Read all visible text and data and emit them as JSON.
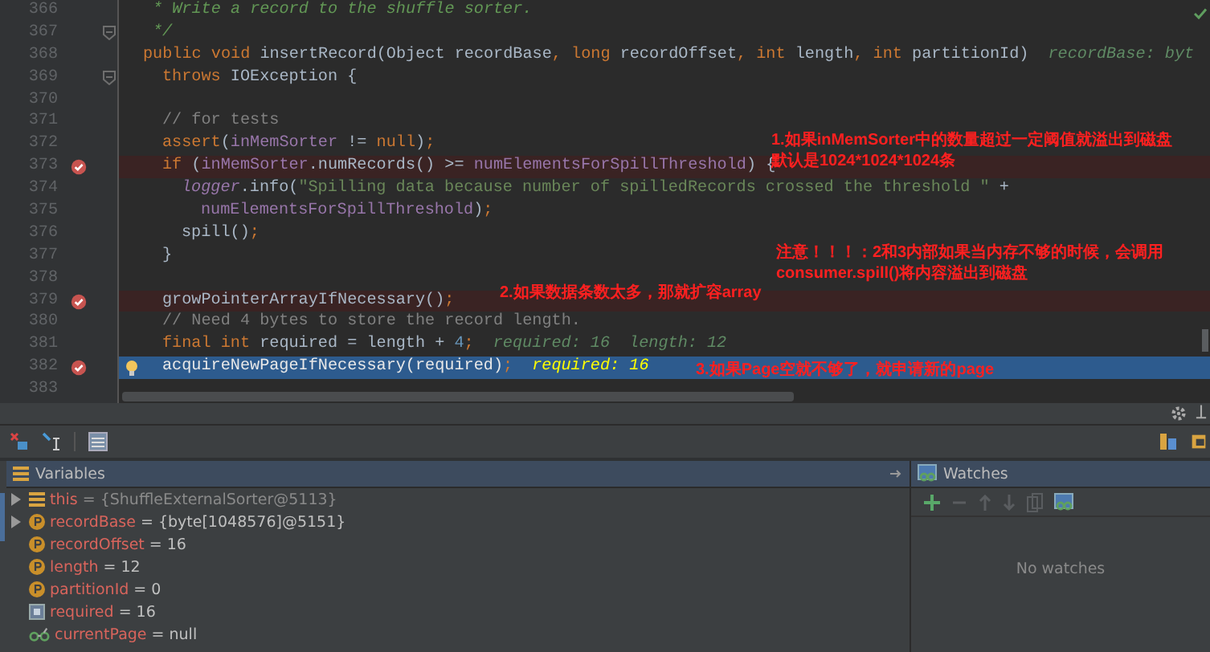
{
  "editor": {
    "lines": [
      {
        "number": "366",
        "tokens": [
          {
            "kind": "doc",
            "text": " * Write a record to the shuffle sorter."
          }
        ]
      },
      {
        "number": "367",
        "fold": true,
        "tokens": [
          {
            "kind": "doc",
            "text": " */"
          }
        ]
      },
      {
        "number": "368",
        "tokens": [
          {
            "kind": "keyword",
            "text": "public void "
          },
          {
            "kind": "plain",
            "text": "insertRecord(Object recordBase"
          },
          {
            "kind": "keyword",
            "text": ", long "
          },
          {
            "kind": "plain",
            "text": "recordOffset"
          },
          {
            "kind": "keyword",
            "text": ", int "
          },
          {
            "kind": "plain",
            "text": "length"
          },
          {
            "kind": "keyword",
            "text": ", int "
          },
          {
            "kind": "plain",
            "text": "partitionId)"
          }
        ],
        "hints": [
          "recordBase: byt"
        ]
      },
      {
        "number": "369",
        "fold": true,
        "tokens": [
          {
            "kind": "keyword",
            "text": "  throws "
          },
          {
            "kind": "plain",
            "text": "IOException {"
          }
        ]
      },
      {
        "number": "370"
      },
      {
        "number": "371",
        "tokens": [
          {
            "kind": "comment",
            "text": "  // for tests"
          }
        ]
      },
      {
        "number": "372",
        "tokens": [
          {
            "kind": "keyword",
            "text": "  assert"
          },
          {
            "kind": "plain",
            "text": "("
          },
          {
            "kind": "field",
            "text": "inMemSorter"
          },
          {
            "kind": "plain",
            "text": " != "
          },
          {
            "kind": "keyword",
            "text": "null"
          },
          {
            "kind": "plain",
            "text": ")"
          },
          {
            "kind": "keyword",
            "text": ";"
          }
        ]
      },
      {
        "number": "373",
        "breakpoint": true,
        "tokens": [
          {
            "kind": "keyword",
            "text": "  if "
          },
          {
            "kind": "plain",
            "text": "("
          },
          {
            "kind": "field",
            "text": "inMemSorter"
          },
          {
            "kind": "plain",
            "text": ".numRecords() >= "
          },
          {
            "kind": "field",
            "text": "numElementsForSpillThreshold"
          },
          {
            "kind": "plain",
            "text": ") {"
          }
        ]
      },
      {
        "number": "374",
        "tokens": [
          {
            "kind": "static",
            "text": "    logger"
          },
          {
            "kind": "plain",
            "text": ".info("
          },
          {
            "kind": "string",
            "text": "\"Spilling data because number of spilledRecords crossed the threshold \""
          },
          {
            "kind": "plain",
            "text": " +"
          }
        ]
      },
      {
        "number": "375",
        "tokens": [
          {
            "kind": "field",
            "text": "      numElementsForSpillThreshold"
          },
          {
            "kind": "plain",
            "text": ")"
          },
          {
            "kind": "keyword",
            "text": ";"
          }
        ]
      },
      {
        "number": "376",
        "tokens": [
          {
            "kind": "plain",
            "text": "    spill()"
          },
          {
            "kind": "keyword",
            "text": ";"
          }
        ]
      },
      {
        "number": "377",
        "tokens": [
          {
            "kind": "plain",
            "text": "  }"
          }
        ]
      },
      {
        "number": "378"
      },
      {
        "number": "379",
        "breakpoint": true,
        "tokens": [
          {
            "kind": "plain",
            "text": "  growPointerArrayIfNecessary()"
          },
          {
            "kind": "keyword",
            "text": ";"
          }
        ]
      },
      {
        "number": "380",
        "tokens": [
          {
            "kind": "comment",
            "text": "  // Need 4 bytes to store the record length."
          }
        ]
      },
      {
        "number": "381",
        "tokens": [
          {
            "kind": "keyword",
            "text": "  final int "
          },
          {
            "kind": "plain",
            "text": "required = length + "
          },
          {
            "kind": "number",
            "text": "4"
          },
          {
            "kind": "keyword",
            "text": ";"
          }
        ],
        "hints": [
          "required: 16",
          "length: 12"
        ]
      },
      {
        "number": "382",
        "breakpoint": true,
        "bulb": true,
        "current": true,
        "tokens": [
          {
            "kind": "plain",
            "text": "  acquireNewPageIfNecessary(required)"
          },
          {
            "kind": "keyword",
            "text": ";"
          }
        ],
        "hints": [
          "required: 16"
        ]
      },
      {
        "number": "383"
      }
    ]
  },
  "annotations": [
    {
      "lines": [
        "1.如果inMemSorter中的数量超过一定阈值就溢出到磁盘",
        "默认是1024*1024*1024条"
      ]
    },
    {
      "lines": [
        "注意！！！：2和3内部如果当内存不够的时候，会调用",
        "consumer.spill()将内容溢出到磁盘"
      ]
    },
    {
      "lines": [
        "2.如果数据条数太多，那就扩容array"
      ]
    },
    {
      "lines": [
        "3.如果Page空就不够了，就申请新的page"
      ]
    }
  ],
  "debugger": {
    "variables": {
      "title": "Variables",
      "items": [
        {
          "kind": "object",
          "expandable": true,
          "name": "this",
          "value": "= {ShuffleExternalSorter@5113}"
        },
        {
          "kind": "parameter",
          "expandable": true,
          "name": "recordBase",
          "value": "= {byte[1048576]@5151}"
        },
        {
          "kind": "parameter",
          "name": "recordOffset",
          "value": "= 16"
        },
        {
          "kind": "parameter",
          "name": "length",
          "value": "= 12"
        },
        {
          "kind": "parameter",
          "name": "partitionId",
          "value": "= 0"
        },
        {
          "kind": "local",
          "name": "required",
          "value": "= 16"
        },
        {
          "kind": "field",
          "name": "currentPage",
          "value": "= null"
        }
      ]
    },
    "watches": {
      "title": "Watches",
      "empty_text": "No watches"
    }
  }
}
